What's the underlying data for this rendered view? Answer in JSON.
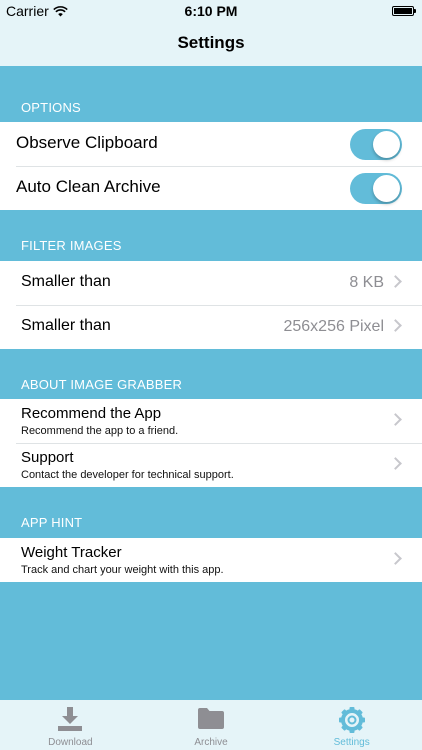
{
  "status_bar": {
    "carrier": "Carrier",
    "time": "6:10 PM"
  },
  "nav": {
    "title": "Settings"
  },
  "sections": {
    "options": {
      "header": "OPTIONS",
      "rows": [
        {
          "label": "Observe Clipboard",
          "toggle_on": true
        },
        {
          "label": "Auto Clean Archive",
          "toggle_on": true
        }
      ]
    },
    "filter_images": {
      "header": "FILTER IMAGES",
      "rows": [
        {
          "label": "Smaller than",
          "value": "8 KB"
        },
        {
          "label": "Smaller than",
          "value": "256x256 Pixel"
        }
      ]
    },
    "about": {
      "header": "ABOUT IMAGE GRABBER",
      "rows": [
        {
          "title": "Recommend the App",
          "subtitle": "Recommend the app to a friend."
        },
        {
          "title": "Support",
          "subtitle": "Contact the developer for technical support."
        }
      ]
    },
    "app_hint": {
      "header": "APP HINT",
      "rows": [
        {
          "title": "Weight Tracker",
          "subtitle": "Track and chart your weight with this app."
        }
      ]
    }
  },
  "tabbar": {
    "tabs": [
      {
        "label": "Download",
        "icon": "download-icon"
      },
      {
        "label": "Archive",
        "icon": "folder-icon"
      },
      {
        "label": "Settings",
        "icon": "gear-icon"
      }
    ],
    "active_index": 2
  },
  "colors": {
    "accent": "#62bcd9",
    "bar_background": "#e5f4f8",
    "value_text": "#8e8e93"
  }
}
